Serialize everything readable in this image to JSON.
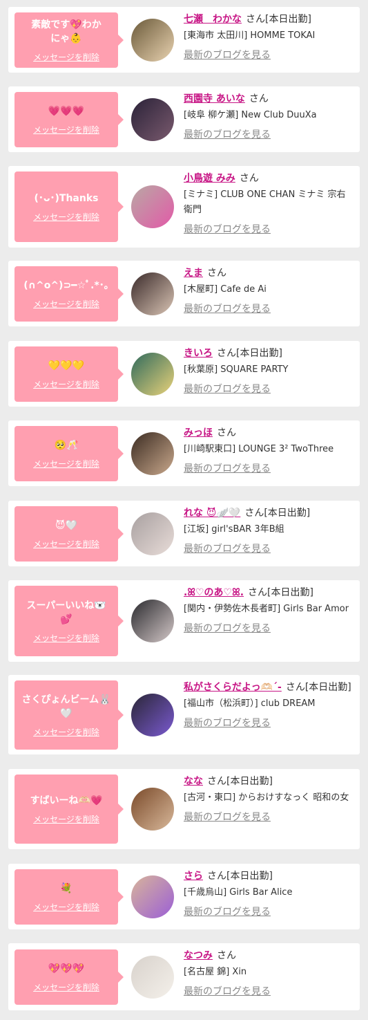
{
  "delete_label": "メッセージを削除",
  "blog_label": "最新のブログを見る",
  "items": [
    {
      "message": "素敵です💖わか\nにゃ👶",
      "name": "七瀬　わかな",
      "suffix": "さん[本日出勤]",
      "shop": "[東海市 太田川] HOMME TOKAI",
      "avatar_colors": [
        "#6b5a3a",
        "#e8d2b0"
      ]
    },
    {
      "message": "💗💗💗",
      "name": "西園寺 あいな",
      "suffix": "さん",
      "shop": "[岐阜 柳ケ瀬] New Club DuuXa",
      "avatar_colors": [
        "#2a2238",
        "#7a5a6e"
      ]
    },
    {
      "message": "(･ᴗ･)Thanks",
      "name": "小鳥遊 みみ",
      "suffix": "さん",
      "shop": "[ミナミ] CLUB ONE CHAN ミナミ 宗右衛門",
      "avatar_colors": [
        "#b9a8a4",
        "#e25aa8"
      ]
    },
    {
      "message": "(∩^o^)⊃━☆ﾟ.*･｡",
      "name": "えま",
      "suffix": "さん",
      "shop": "[木屋町] Cafe de Ai",
      "avatar_colors": [
        "#3a2a2a",
        "#d9c4b4"
      ]
    },
    {
      "message": "💛💛💛",
      "name": "きいろ",
      "suffix": "さん[本日出勤]",
      "shop": "[秋葉原] SQUARE PARTY",
      "avatar_colors": [
        "#2f6a5c",
        "#e9d27a"
      ]
    },
    {
      "message": "🥺🥂",
      "name": "みっほ",
      "suffix": "さん",
      "shop": "[川崎駅東口] LOUNGE 3² TwoThree",
      "avatar_colors": [
        "#3b2c22",
        "#c9a88c"
      ]
    },
    {
      "message": "😈🤍",
      "name": "れな 😈🪽🤍",
      "suffix": "さん[本日出勤]",
      "shop": "[江坂] girl'sBAR 3年B組",
      "avatar_colors": [
        "#a8a0a0",
        "#e8dcd8"
      ]
    },
    {
      "message": "スーパーいいね🐻‍❄️\n💕",
      "name": ".ꕤ♡のあ♡ꕤ.",
      "suffix": "さん[本日出勤]",
      "shop": "[関内・伊勢佐木長者町] Girls Bar Amor",
      "avatar_colors": [
        "#2a2a2e",
        "#d4c8c8"
      ]
    },
    {
      "message": "さくぴょんビーム🐰\n🤍",
      "name": "私がさくらだよっ🫶🏻ˊ-",
      "suffix": "さん[本日出勤]",
      "shop": "[福山市（松浜町）] club DREAM",
      "avatar_colors": [
        "#2a2636",
        "#7a5ad0"
      ]
    },
    {
      "message": "すばいーね🫶🏻💗",
      "name": "なな",
      "suffix": "さん[本日出勤]",
      "shop": "[古河・東口] からおけすなっく 昭和の女",
      "avatar_colors": [
        "#7a4a2a",
        "#d8b89a"
      ]
    },
    {
      "message": "💐",
      "name": "さら",
      "suffix": "さん[本日出勤]",
      "shop": "[千歳烏山] Girls Bar Alice",
      "avatar_colors": [
        "#d8b49a",
        "#9b5fd6"
      ]
    },
    {
      "message": "💖💖💖",
      "name": "なつみ",
      "suffix": "さん",
      "shop": "[名古屋 錦] Xin",
      "avatar_colors": [
        "#d8d2cc",
        "#f4f0ea"
      ]
    }
  ]
}
